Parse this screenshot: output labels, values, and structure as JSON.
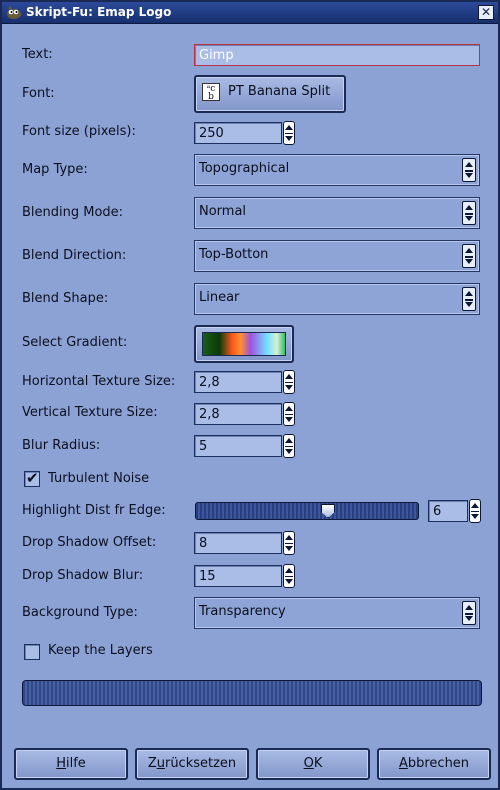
{
  "window": {
    "title": "Skript-Fu: Emap Logo",
    "close_glyph": "✕"
  },
  "fields": {
    "text": {
      "label": "Text:",
      "value": "Gimp"
    },
    "font": {
      "label": "Font:",
      "value": "PT Banana Split",
      "icon_glyph": "ᵃc\nb"
    },
    "font_size": {
      "label": "Font size (pixels):",
      "value": "250"
    },
    "map_type": {
      "label": "Map Type:",
      "value": "Topographical"
    },
    "blending_mode": {
      "label": "Blending Mode:",
      "value": "Normal"
    },
    "blend_direction": {
      "label": "Blend Direction:",
      "value": "Top-Botton"
    },
    "blend_shape": {
      "label": "Blend Shape:",
      "value": "Linear"
    },
    "gradient": {
      "label": "Select Gradient:"
    },
    "h_texture": {
      "label": "Horizontal Texture Size:",
      "value": "2,8"
    },
    "v_texture": {
      "label": "Vertical Texture Size:",
      "value": "2,8"
    },
    "blur_radius": {
      "label": "Blur Radius:",
      "value": "5"
    },
    "turbulent_noise": {
      "label": "Turbulent Noise",
      "checked": true,
      "mark": "✔"
    },
    "highlight_dist": {
      "label": "Highlight Dist fr Edge:",
      "value": "6",
      "fraction": 0.6
    },
    "drop_shadow_offset": {
      "label": "Drop Shadow Offset:",
      "value": "8"
    },
    "drop_shadow_blur": {
      "label": "Drop Shadow Blur:",
      "value": "15"
    },
    "background_type": {
      "label": "Background Type:",
      "value": "Transparency"
    },
    "keep_layers": {
      "label": "Keep the Layers",
      "checked": false
    }
  },
  "buttons": {
    "help": {
      "label_u": "H",
      "label_rest": "ilfe"
    },
    "reset": {
      "label_pre": "Z",
      "label_u": "u",
      "label_rest": "rücksetzen"
    },
    "ok": {
      "label_u": "O",
      "label_rest": "K"
    },
    "cancel": {
      "label_u": "A",
      "label_rest": "bbrechen"
    }
  },
  "icons": {
    "title": "gimp-wilber-icon",
    "close": "close-icon",
    "font": "font-icon",
    "spin": "spin-arrows-icon",
    "dropdown": "dropdown-arrow-icon",
    "check": "checkmark-icon"
  }
}
